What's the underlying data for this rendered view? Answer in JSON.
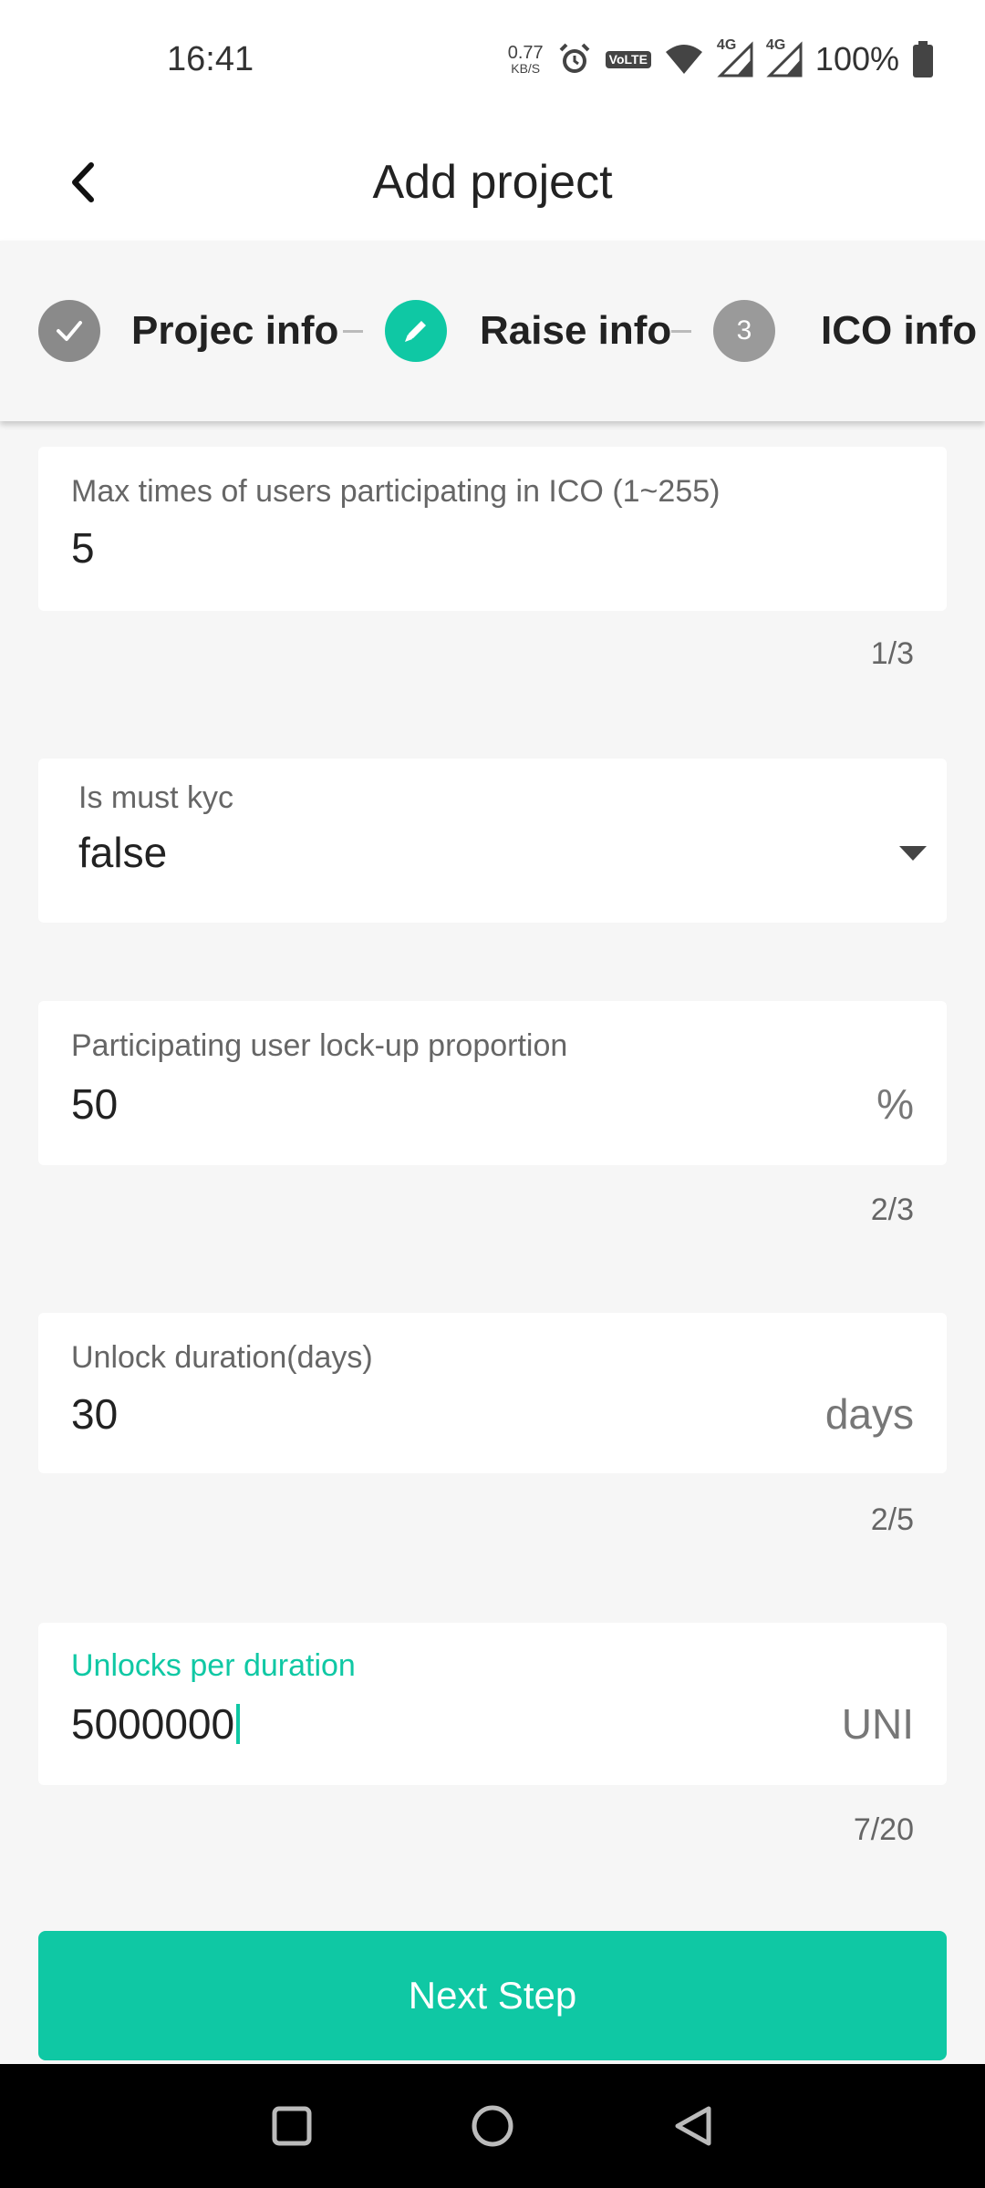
{
  "status_bar": {
    "time": "16:41",
    "net_speed_value": "0.77",
    "net_speed_unit": "KB/S",
    "volte_top": "Vo",
    "volte_bottom": "LTE",
    "network_1": "4G",
    "network_2": "4G",
    "battery": "100%"
  },
  "header": {
    "title": "Add project"
  },
  "stepper": {
    "steps": [
      {
        "label": "Projec info",
        "state": "done"
      },
      {
        "label": "Raise info",
        "state": "active"
      },
      {
        "label": "ICO info",
        "state": "pending",
        "number": "3"
      }
    ]
  },
  "form": {
    "max_times": {
      "label": "Max times of users participating in ICO (1~255)",
      "value": "5",
      "counter": "1/3"
    },
    "kyc": {
      "label": "Is must kyc",
      "value": "false"
    },
    "lockup": {
      "label": "Participating user lock-up proportion",
      "value": "50",
      "suffix": "%",
      "counter": "2/3"
    },
    "unlock_duration": {
      "label": "Unlock duration(days)",
      "value": "30",
      "suffix": "days",
      "counter": "2/5"
    },
    "unlocks_per_duration": {
      "label": "Unlocks per duration",
      "value": "5000000",
      "suffix": "UNI",
      "counter": "7/20"
    }
  },
  "actions": {
    "next_label": "Next Step"
  },
  "colors": {
    "accent": "#0fc8a4",
    "done_grey": "#8a8a8a",
    "pending_grey": "#9a9a9a"
  }
}
